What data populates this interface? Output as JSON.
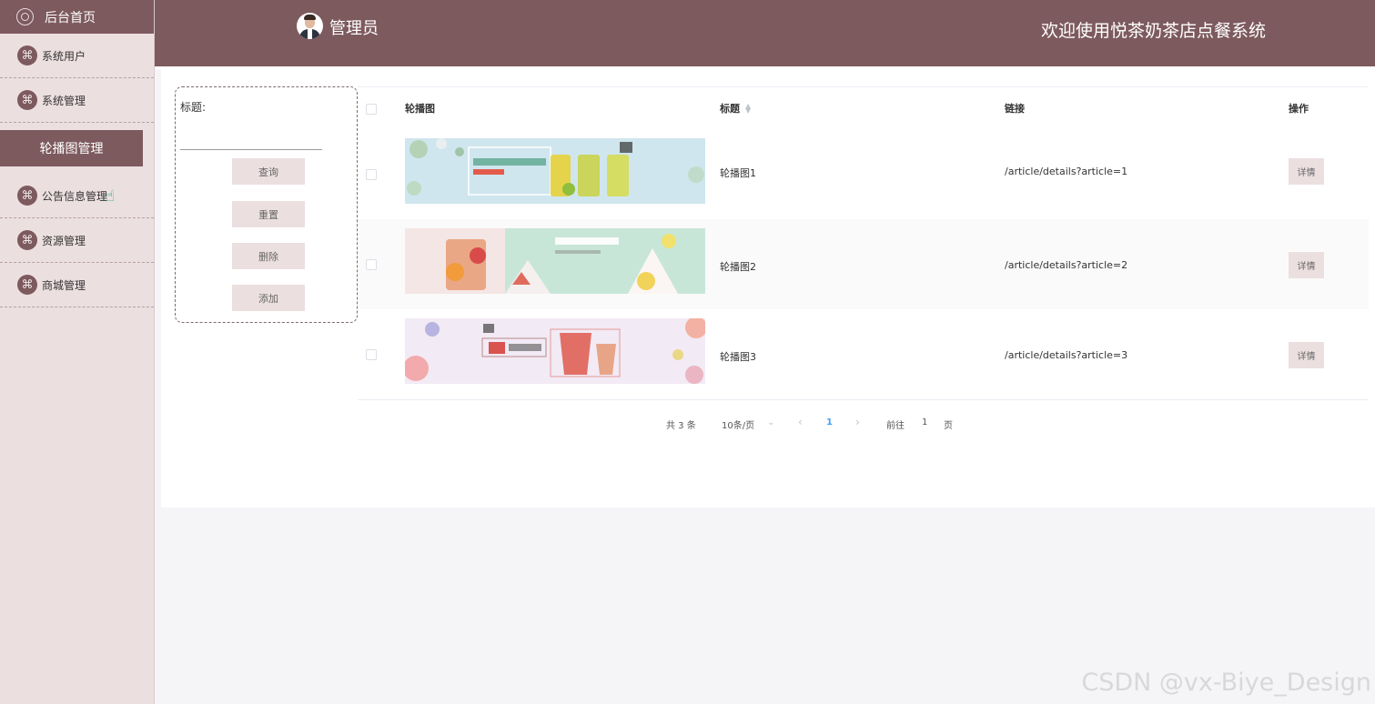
{
  "sidebar": {
    "home_label": "后台首页",
    "items": [
      {
        "label": "系统用户",
        "icon": "flower-icon",
        "active": false
      },
      {
        "label": "系统管理",
        "icon": "flower-icon",
        "active": false
      },
      {
        "label": "轮播图管理",
        "icon": "",
        "active": true
      },
      {
        "label": "公告信息管理",
        "icon": "flower-icon",
        "active": false
      },
      {
        "label": "资源管理",
        "icon": "flower-icon",
        "active": false
      },
      {
        "label": "商城管理",
        "icon": "flower-icon",
        "active": false
      }
    ]
  },
  "header": {
    "admin_name": "管理员",
    "welcome": "欢迎使用悦茶奶茶店点餐系统"
  },
  "search": {
    "title_label": "标题:",
    "title_value": "",
    "query_label": "查询",
    "reset_label": "重置",
    "delete_label": "删除",
    "add_label": "添加"
  },
  "table": {
    "columns": [
      "轮播图",
      "标题",
      "链接",
      "操作"
    ],
    "rows": [
      {
        "title": "轮播图1",
        "link": "/article/details?article=1",
        "action": "详情"
      },
      {
        "title": "轮播图2",
        "link": "/article/details?article=2",
        "action": "详情"
      },
      {
        "title": "轮播图3",
        "link": "/article/details?article=3",
        "action": "详情"
      }
    ]
  },
  "pagination": {
    "total": "共 3 条",
    "page_size": "10条/页",
    "prev": "‹",
    "current": "1",
    "next": "›",
    "goto_label": "前往",
    "goto_value": "1",
    "page_suffix": "页"
  },
  "watermark": "CSDN @vx-Biye_Design",
  "colors": {
    "primary": "#7d5a5e",
    "sidebar_bg": "#ecdfe0",
    "button_bg": "#ecdfe0"
  }
}
